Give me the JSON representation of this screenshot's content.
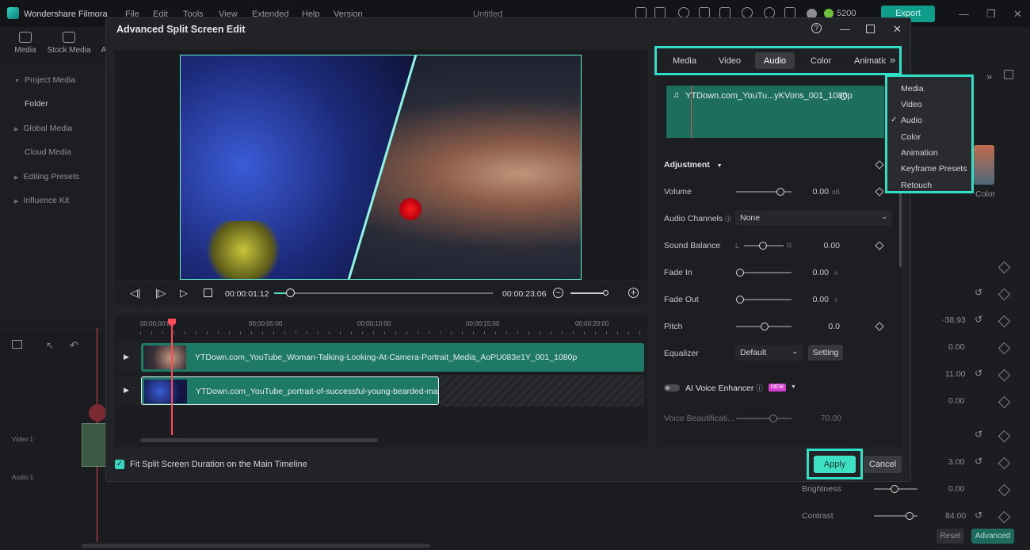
{
  "app": {
    "name": "Wondershare Filmora",
    "menu": [
      "File",
      "Edit",
      "Tools",
      "View",
      "Extended",
      "Help",
      "Version"
    ],
    "title": "Untitled",
    "credits": "5200",
    "export_label": "Export"
  },
  "left_tabs": [
    "Media",
    "Stock Media",
    "A"
  ],
  "sidebar": {
    "items": [
      {
        "label": "Project Media",
        "sub": false
      },
      {
        "label": "Folder",
        "sub": true
      },
      {
        "label": "Global Media",
        "sub": false
      },
      {
        "label": "Cloud Media",
        "sub": true
      },
      {
        "label": "Editing Presets",
        "sub": false
      },
      {
        "label": "Influence Kit",
        "sub": false
      }
    ]
  },
  "left_timeline": {
    "video_track": "Video 1",
    "audio_track": "Audio 1"
  },
  "right_panel": {
    "values": [
      "-38.93",
      "0.00",
      "11.00",
      "0.00",
      "3.00",
      "0.00",
      "84.00"
    ],
    "brightness_label": "Brightness",
    "contrast_label": "Contrast",
    "reset_label": "Reset",
    "advanced_label": "Advanced",
    "color_label": "Color"
  },
  "dialog": {
    "title": "Advanced Split Screen Edit",
    "current_time": "00:00:01:12",
    "total_time": "00:00:23:06",
    "ruler": [
      "00:00:00:00",
      "00:00:05:00",
      "00:00:10:00",
      "00:00:15:00",
      "00:00:20:00"
    ],
    "clips": [
      "YTDown.com_YouTube_Woman-Talking-Looking-At-Camera-Portrait_Media_AoPU083e1Y_001_1080p",
      "YTDown.com_YouTube_portrait-of-successful-young-bearded-man_f"
    ],
    "fit_label": "Fit Split Screen Duration on the Main Timeline",
    "apply_label": "Apply",
    "cancel_label": "Cancel"
  },
  "properties": {
    "tabs": [
      "Media",
      "Video",
      "Audio",
      "Color",
      "Animatic"
    ],
    "active_tab": "Audio",
    "audio_clip_name": "YTDown.com_YouTu...yKVons_001_1080p",
    "adjustment_label": "Adjustment",
    "volume": {
      "label": "Volume",
      "value": "0.00",
      "unit": "dB"
    },
    "audio_channels": {
      "label": "Audio Channels",
      "value": "None"
    },
    "sound_balance": {
      "label": "Sound Balance",
      "left": "L",
      "right": "R",
      "value": "0.00"
    },
    "fade_in": {
      "label": "Fade In",
      "value": "0.00",
      "unit": "s"
    },
    "fade_out": {
      "label": "Fade Out",
      "value": "0.00",
      "unit": "s"
    },
    "pitch": {
      "label": "Pitch",
      "value": "0.0"
    },
    "equalizer": {
      "label": "Equalizer",
      "value": "Default",
      "setting": "Setting"
    },
    "ai_voice": {
      "label": "AI Voice Enhancer",
      "badge": "NEW"
    },
    "voice_beautification": {
      "label": "Voice Beautificati...",
      "value": "70.00"
    }
  },
  "dropdown": {
    "items": [
      "Media",
      "Video",
      "Audio",
      "Color",
      "Animation",
      "Keyframe Presets",
      "Retouch"
    ],
    "checked": "Audio"
  }
}
